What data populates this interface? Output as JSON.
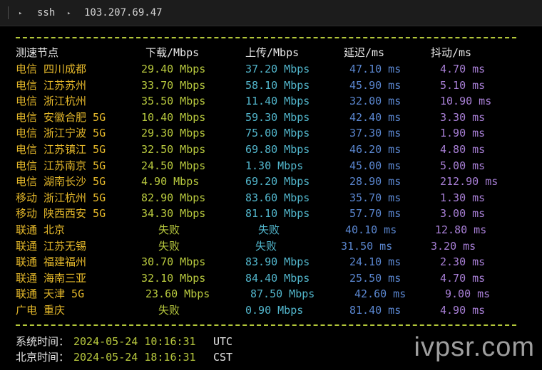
{
  "tab": {
    "arrow": "▸",
    "label": "ssh",
    "host": "103.207.69.47"
  },
  "table": {
    "headers": {
      "node": "测速节点",
      "download": "下载/Mbps",
      "upload": "上传/Mbps",
      "latency": "延迟/ms",
      "jitter": "抖动/ms"
    },
    "rows": [
      {
        "node": "电信 四川成都",
        "download": "29.40 Mbps",
        "upload": "37.20 Mbps",
        "latency": "47.10 ms",
        "jitter": "4.70 ms"
      },
      {
        "node": "电信 江苏苏州",
        "download": "33.70 Mbps",
        "upload": "58.10 Mbps",
        "latency": "45.90 ms",
        "jitter": "5.10 ms"
      },
      {
        "node": "电信 浙江杭州",
        "download": "35.50 Mbps",
        "upload": "11.40 Mbps",
        "latency": "32.00 ms",
        "jitter": "10.90 ms"
      },
      {
        "node": "电信 安徽合肥 5G",
        "download": "10.40 Mbps",
        "upload": "59.30 Mbps",
        "latency": "42.40 ms",
        "jitter": "3.30 ms"
      },
      {
        "node": "电信 浙江宁波 5G",
        "download": "29.30 Mbps",
        "upload": "75.00 Mbps",
        "latency": "37.30 ms",
        "jitter": "1.90 ms"
      },
      {
        "node": "电信 江苏镇江 5G",
        "download": "32.50 Mbps",
        "upload": "69.80 Mbps",
        "latency": "46.20 ms",
        "jitter": "4.80 ms"
      },
      {
        "node": "电信 江苏南京 5G",
        "download": "24.50 Mbps",
        "upload": "1.30 Mbps",
        "latency": "45.00 ms",
        "jitter": "5.00 ms"
      },
      {
        "node": "电信 湖南长沙 5G",
        "download": "4.90 Mbps",
        "upload": "69.20 Mbps",
        "latency": "28.90 ms",
        "jitter": "212.90 ms"
      },
      {
        "node": "移动 浙江杭州 5G",
        "download": "82.90 Mbps",
        "upload": "83.60 Mbps",
        "latency": "35.70 ms",
        "jitter": "1.30 ms"
      },
      {
        "node": "移动 陕西西安 5G",
        "download": "34.30 Mbps",
        "upload": "81.10 Mbps",
        "latency": "57.70 ms",
        "jitter": "3.00 ms"
      },
      {
        "node": "联通 北京",
        "download": "失败",
        "upload": "失败",
        "latency": "40.10 ms",
        "jitter": "12.80 ms"
      },
      {
        "node": "联通 江苏无锡",
        "download": "失败",
        "upload": "失败",
        "latency": "31.50 ms",
        "jitter": "3.20 ms"
      },
      {
        "node": "联通 福建福州",
        "download": "30.70 Mbps",
        "upload": "83.90 Mbps",
        "latency": "24.10 ms",
        "jitter": "2.30 ms"
      },
      {
        "node": "联通 海南三亚",
        "download": "32.10 Mbps",
        "upload": "84.40 Mbps",
        "latency": "25.50 ms",
        "jitter": "4.70 ms"
      },
      {
        "node": "联通 天津 5G",
        "download": "23.60 Mbps",
        "upload": "87.50 Mbps",
        "latency": "42.60 ms",
        "jitter": "9.00 ms"
      },
      {
        "node": "广电 重庆",
        "download": "失败",
        "upload": "0.90 Mbps",
        "latency": "81.40 ms",
        "jitter": "4.90 ms"
      }
    ]
  },
  "footer": {
    "system_label": "系统时间：",
    "system_time": "2024-05-24 10:16:31",
    "system_tz": "UTC",
    "beijing_label": "北京时间：",
    "beijing_time": "2024-05-24 18:16:31",
    "beijing_tz": "CST"
  },
  "watermark": "ivpsr.com",
  "colors": {
    "location": "#e5b82a",
    "download": "#b8c93e",
    "upload": "#52b6cc",
    "latency": "#5a86cf",
    "jitter": "#a87fd6",
    "separator": "#b4c83a"
  }
}
